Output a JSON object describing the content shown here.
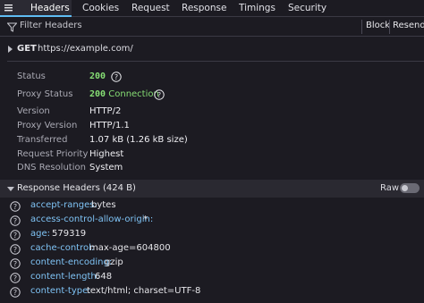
{
  "tabs": [
    {
      "label": "Headers",
      "active": true
    },
    {
      "label": "Cookies",
      "active": false
    },
    {
      "label": "Request",
      "active": false
    },
    {
      "label": "Response",
      "active": false
    },
    {
      "label": "Timings",
      "active": false
    },
    {
      "label": "Security",
      "active": false
    }
  ],
  "filter": {
    "placeholder": "Filter Headers",
    "block_label": "Block",
    "resend_label": "Resend"
  },
  "request": {
    "method": "GET",
    "url": "https://example.com/"
  },
  "summary": {
    "status_label": "Status",
    "status_code": "200",
    "proxy_status_label": "Proxy Status",
    "proxy_status_code": "200",
    "proxy_status_text": "Connection",
    "version_label": "Version",
    "version_value": "HTTP/2",
    "proxy_version_label": "Proxy Version",
    "proxy_version_value": "HTTP/1.1",
    "transferred_label": "Transferred",
    "transferred_value": "1.07 kB (1.26 kB size)",
    "priority_label": "Request Priority",
    "priority_value": "Highest",
    "dns_label": "DNS Resolution",
    "dns_value": "System"
  },
  "response_headers": {
    "title": "Response Headers (424 B)",
    "raw_label": "Raw",
    "raw_enabled": false,
    "rows": [
      {
        "name": "accept-ranges:",
        "value": "bytes"
      },
      {
        "name": "access-control-allow-origin:",
        "value": "*"
      },
      {
        "name": "age:",
        "value": "579319"
      },
      {
        "name": "cache-control:",
        "value": "max-age=604800"
      },
      {
        "name": "content-encoding:",
        "value": "gzip"
      },
      {
        "name": "content-length:",
        "value": "648"
      },
      {
        "name": "content-type:",
        "value": "text/html; charset=UTF-8"
      }
    ]
  },
  "colors": {
    "background": "#1c1b22",
    "accent": "#5fbdf3",
    "status_green": "#86de74",
    "header_name": "#7fc3f5"
  }
}
